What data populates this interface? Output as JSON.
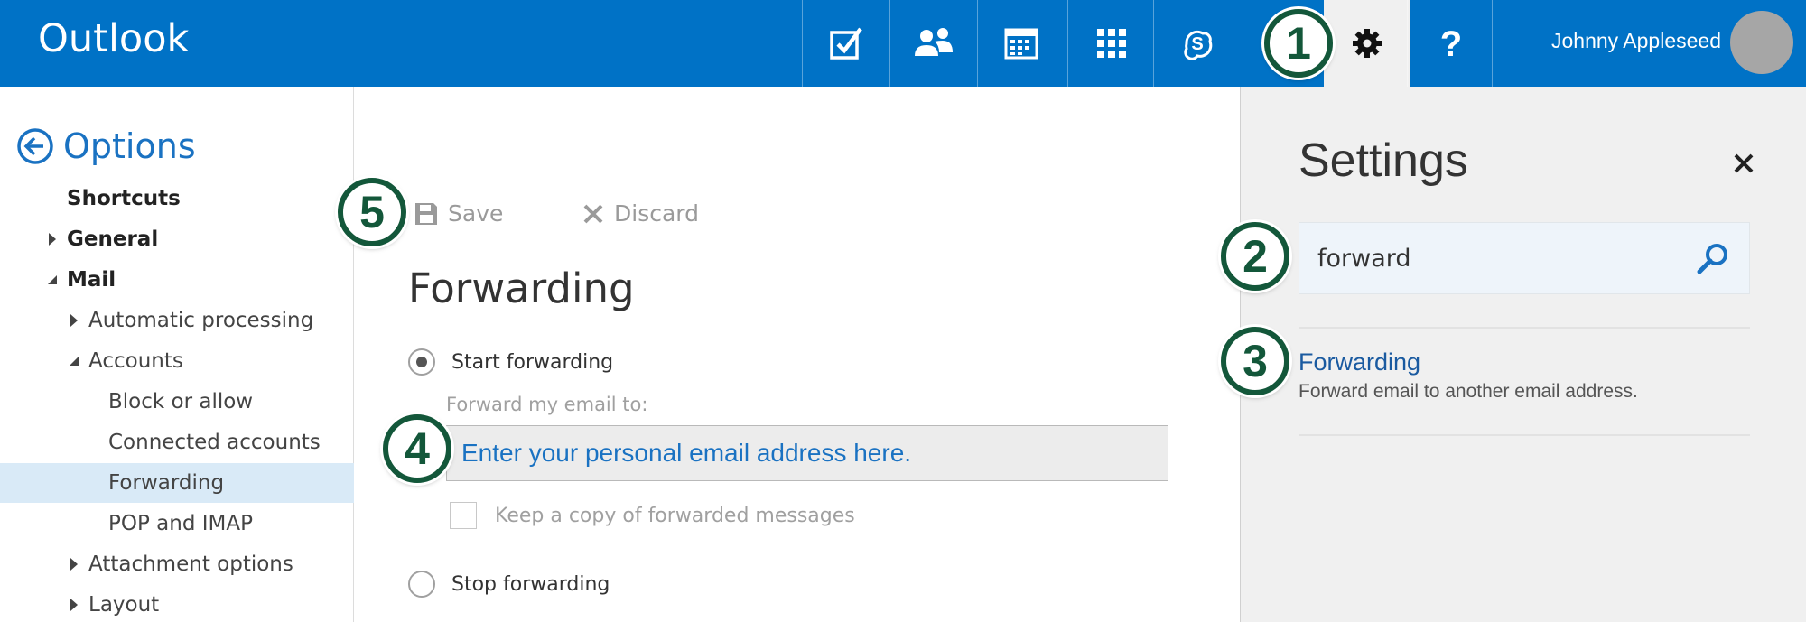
{
  "app": {
    "brand": "Outlook"
  },
  "topbar": {
    "icons": [
      "tasks-icon",
      "people-icon",
      "calendar-icon",
      "app-launcher-icon",
      "skype-icon",
      "gear-icon",
      "help-icon"
    ],
    "user_name": "Johnny Appleseed",
    "accent_color": "#0072c6"
  },
  "callouts": [
    "1",
    "2",
    "3",
    "4",
    "5"
  ],
  "nav": {
    "back_title": "Options",
    "items": [
      {
        "label": "Shortcuts"
      },
      {
        "label": "General"
      },
      {
        "label": "Mail"
      },
      {
        "label": "Automatic processing"
      },
      {
        "label": "Accounts"
      },
      {
        "label": "Block or allow"
      },
      {
        "label": "Connected accounts"
      },
      {
        "label": "Forwarding",
        "selected": true
      },
      {
        "label": "POP and IMAP"
      },
      {
        "label": "Attachment options"
      },
      {
        "label": "Layout"
      }
    ]
  },
  "toolbar": {
    "save_label": "Save",
    "discard_label": "Discard"
  },
  "content": {
    "title": "Forwarding",
    "start_forwarding": "Start forwarding",
    "forward_to_label": "Forward my email to:",
    "email_input_value": "Enter your personal email address here.",
    "keep_copy_label": "Keep a copy of forwarded messages",
    "stop_forwarding": "Stop forwarding"
  },
  "settings": {
    "title": "Settings",
    "search_value": "forward",
    "result_title": "Forwarding",
    "result_description": "Forward email to another email address."
  }
}
